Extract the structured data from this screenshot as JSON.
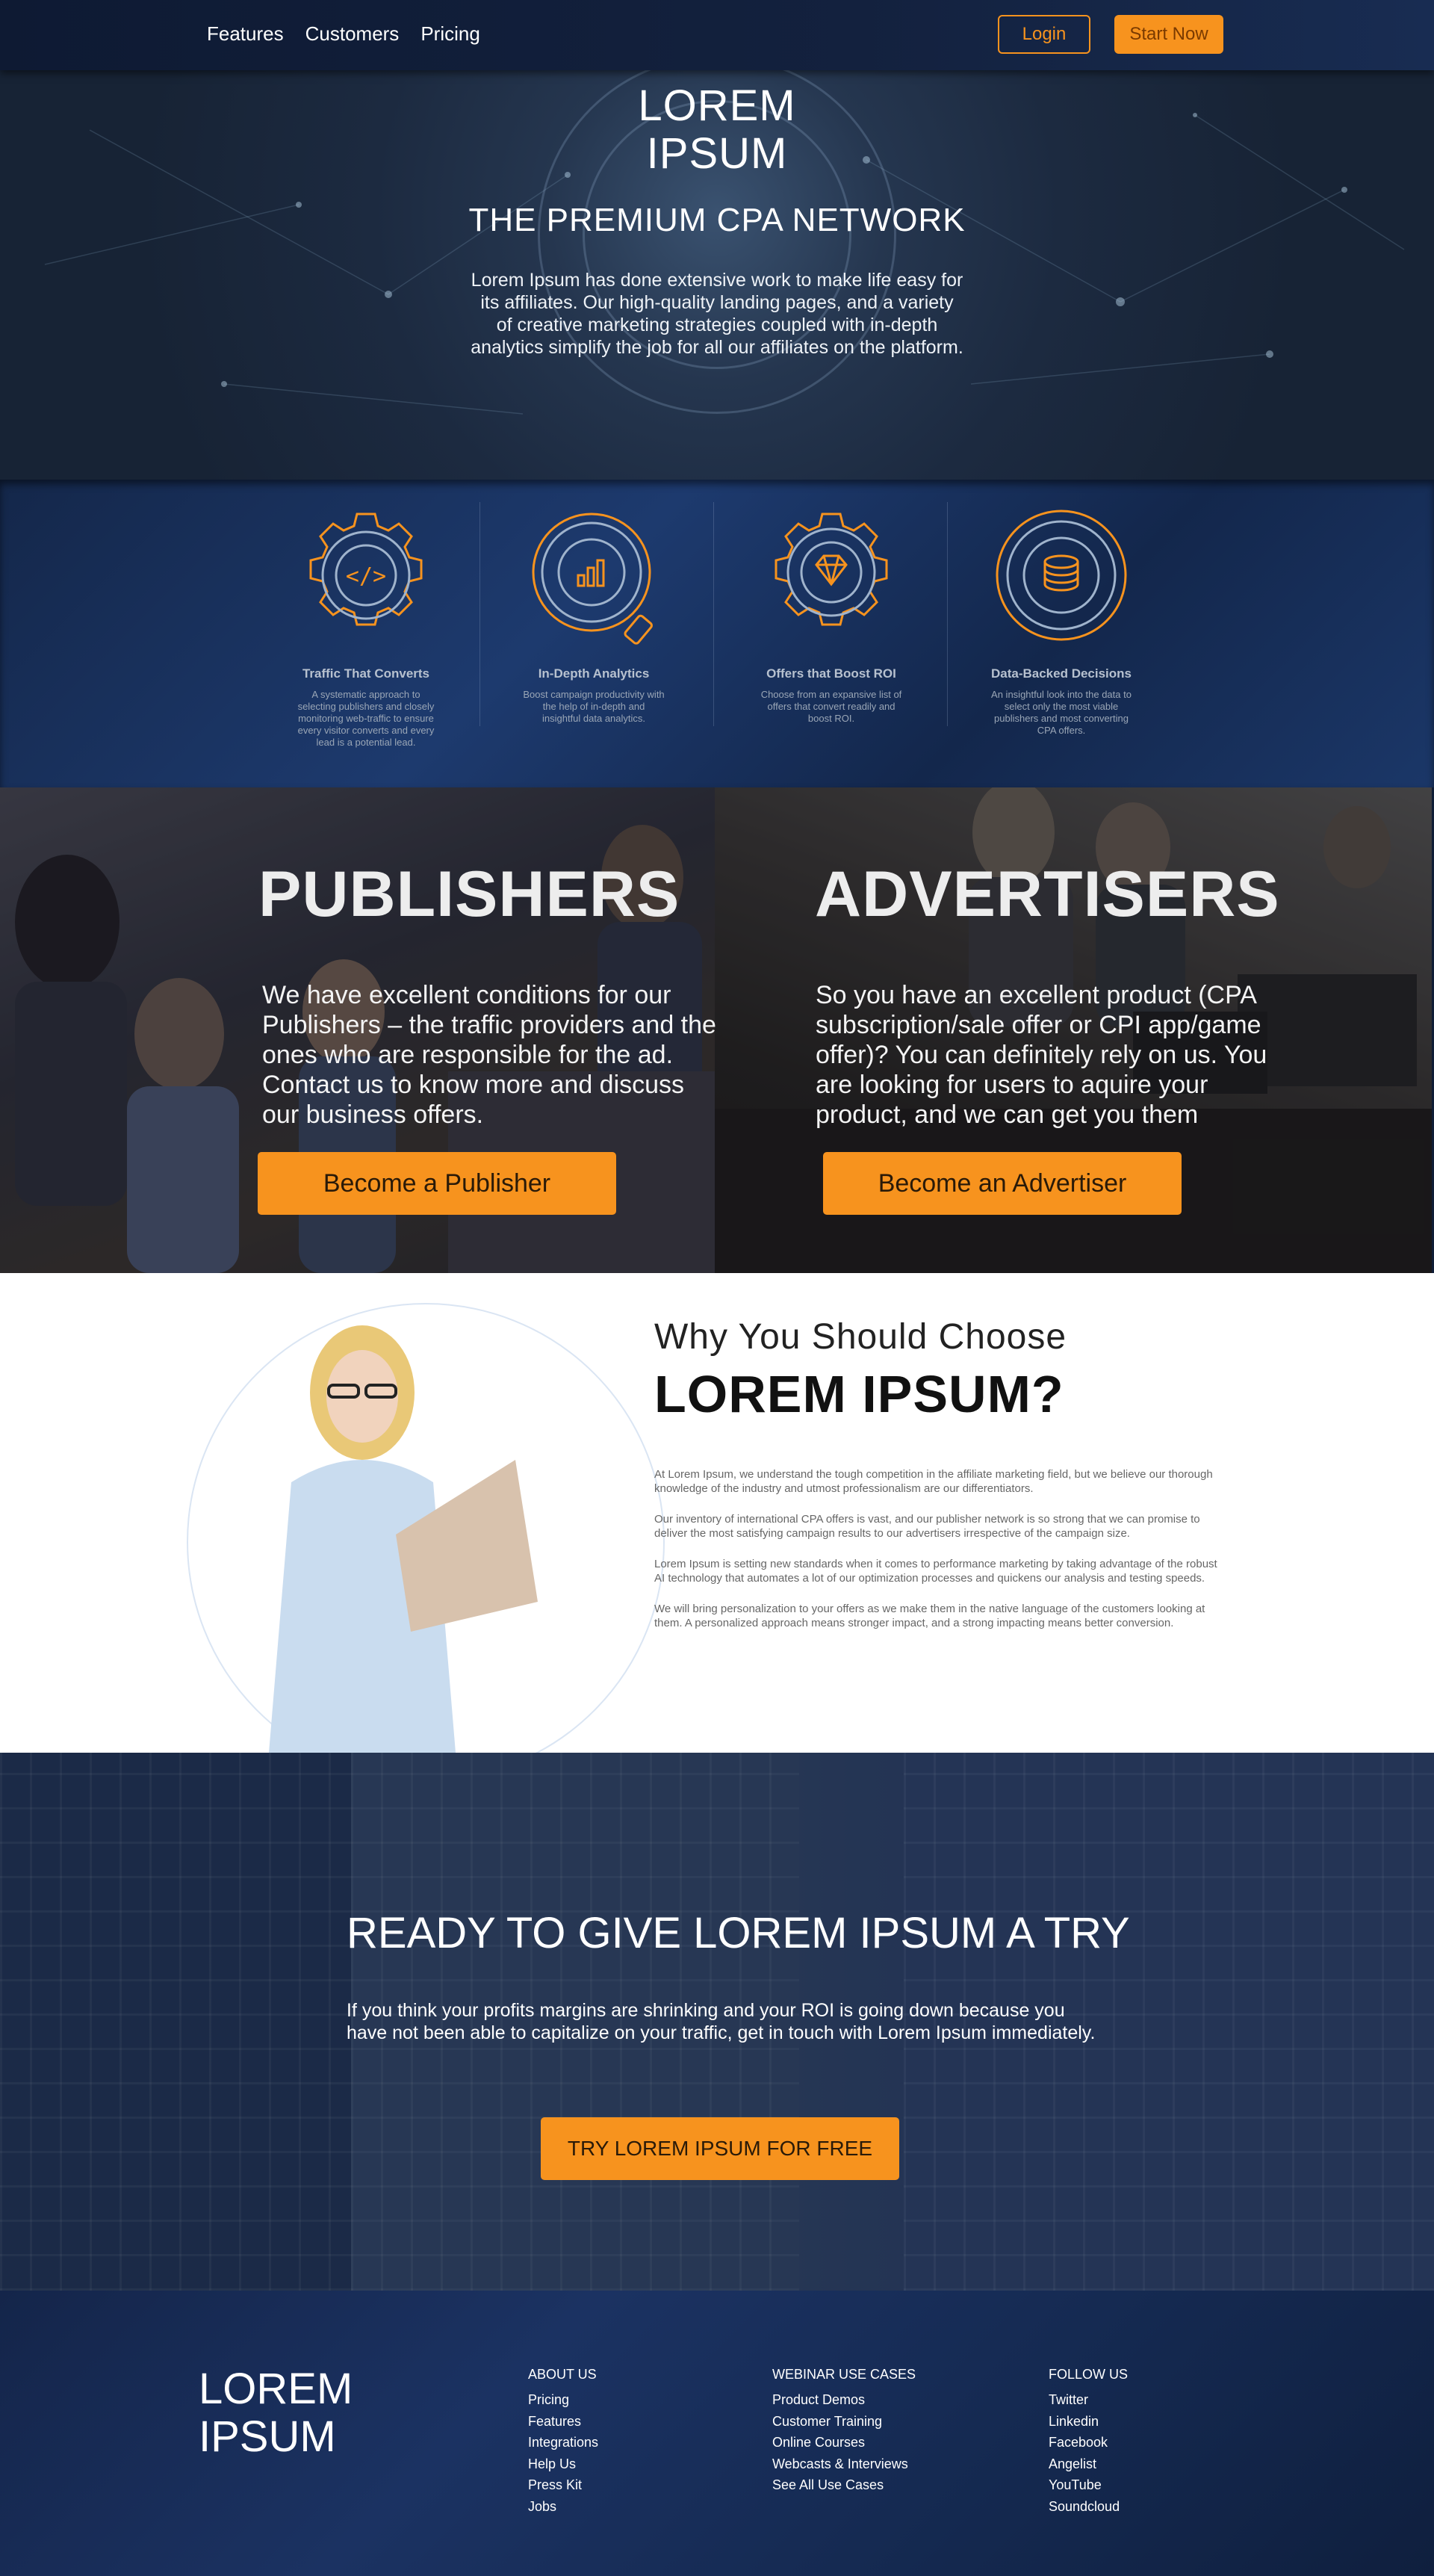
{
  "nav": {
    "links": [
      "Features",
      "Customers",
      "Pricing"
    ],
    "login_label": "Login",
    "start_label": "Start Now"
  },
  "colors": {
    "accent": "#f7931e",
    "navy": "#13213e"
  },
  "hero": {
    "logo_line1": "LOREM",
    "logo_line2": "IPSUM",
    "tagline": "THE PREMIUM CPA NETWORK",
    "description": "Lorem Ipsum has done extensive work to make life easy for its affiliates. Our high-quality landing pages, and a variety of creative marketing strategies coupled with in-depth analytics simplify the job for all our affiliates on the platform."
  },
  "features": [
    {
      "icon": "code-gear-icon",
      "title": "Traffic That Converts",
      "desc": "A systematic approach to selecting publishers and closely monitoring web-traffic to ensure every visitor converts and every lead is a potential lead."
    },
    {
      "icon": "analytics-magnifier-icon",
      "title": "In-Depth Analytics",
      "desc": "Boost campaign productivity with the help of in-depth and insightful data analytics."
    },
    {
      "icon": "diamond-gear-icon",
      "title": "Offers that Boost ROI",
      "desc": "Choose from an expansive list of offers that convert readily and boost ROI."
    },
    {
      "icon": "database-icon",
      "title": "Data-Backed Decisions",
      "desc": "An insightful look into the data to select only the most viable publishers and most converting CPA offers."
    }
  ],
  "publishers": {
    "title": "PUBLISHERS",
    "text": "We have excellent conditions for our Publishers – the traffic providers and the ones who are responsible for the ad. Contact us to know more and discuss our business offers.",
    "button": "Become a Publisher"
  },
  "advertisers": {
    "title": "ADVERTISERS",
    "text": "So you have an excellent product (CPA subscription/sale offer or CPI app/game offer)? You can definitely rely on us. You are looking for users to aquire your product, and we can get you them",
    "button": "Become an Advertiser"
  },
  "why": {
    "subtitle": "Why You Should Choose",
    "title": "LOREM IPSUM?",
    "paragraphs": [
      "At Lorem Ipsum, we understand the tough competition in the affiliate marketing field, but we believe our thorough knowledge of the industry and utmost professionalism are our differentiators.",
      "Our inventory of international CPA offers is vast, and our publisher network is so strong that we can promise to deliver the most satisfying campaign results to our advertisers irrespective of the campaign size.",
      "Lorem Ipsum is setting new standards when it comes to performance marketing by taking advantage of the robust AI technology that automates a lot of our optimization processes and quickens our analysis and testing speeds.",
      "We will bring personalization to your offers as we make them in the native language of the customers looking at them. A personalized approach means stronger impact, and a strong impacting means better conversion."
    ]
  },
  "cta": {
    "title": "READY TO GIVE LOREM IPSUM A TRY",
    "text": "If you think your profits margins are shrinking and your ROI is going down because you have not been able to capitalize on your traffic, get in touch with Lorem Ipsum immediately.",
    "button": "TRY LOREM IPSUM FOR FREE"
  },
  "footer": {
    "logo_line1": "LOREM",
    "logo_line2": "IPSUM",
    "columns": [
      {
        "heading": "ABOUT US",
        "links": [
          "Pricing",
          "Features",
          "Integrations",
          "Help Us",
          "Press Kit",
          "Jobs"
        ]
      },
      {
        "heading": "WEBINAR USE CASES",
        "links": [
          "Product Demos",
          "Customer Training",
          "Online Courses",
          "Webcasts & Interviews",
          "See All Use Cases"
        ]
      },
      {
        "heading": "FOLLOW US",
        "links": [
          "Twitter",
          "Linkedin",
          "Facebook",
          "Angelist",
          "YouTube",
          "Soundcloud"
        ]
      }
    ]
  }
}
